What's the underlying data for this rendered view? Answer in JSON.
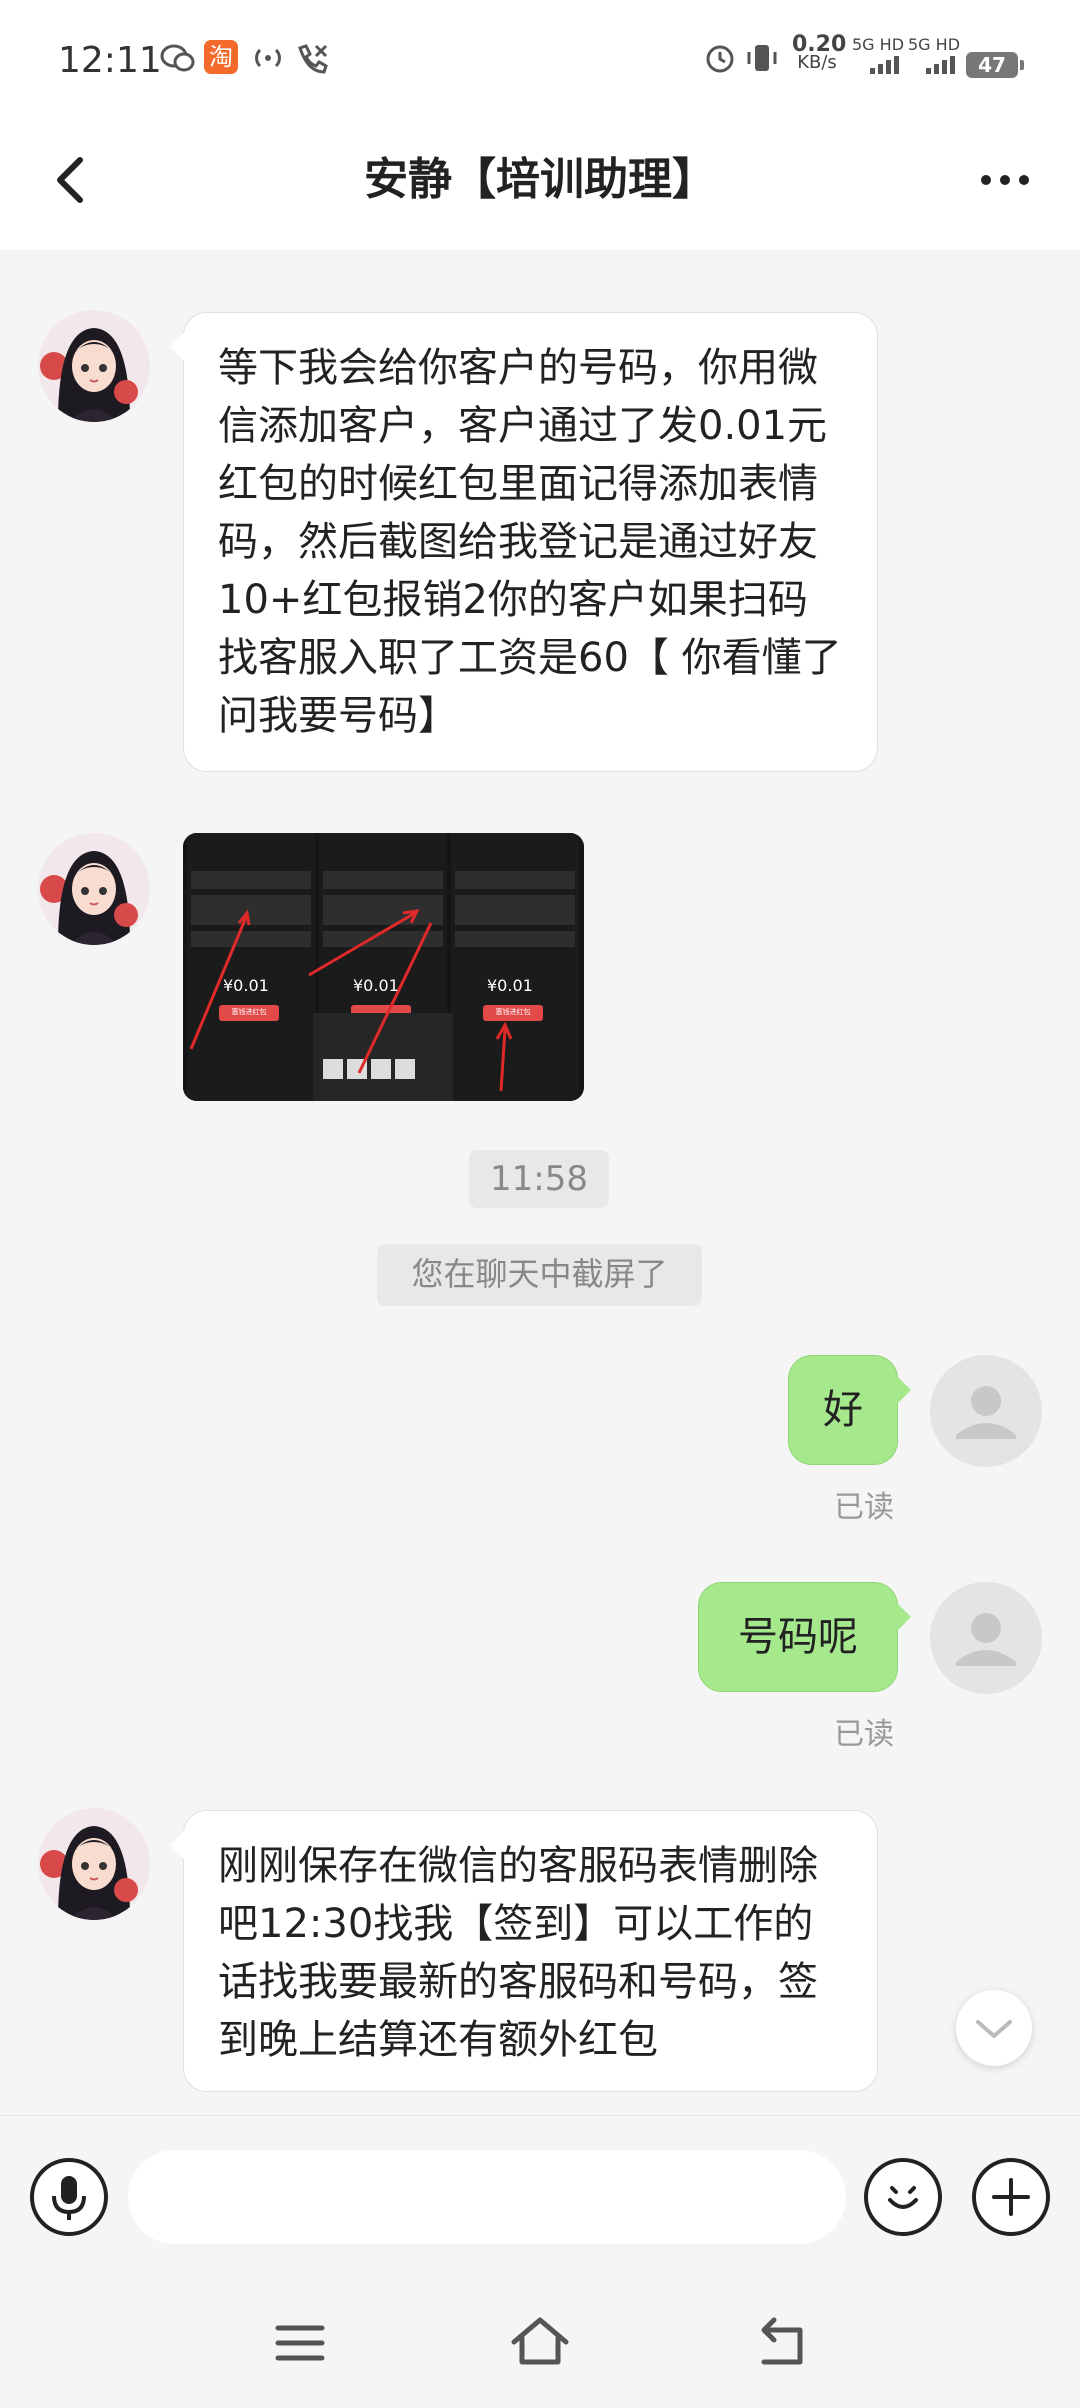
{
  "status_bar": {
    "time": "12:11",
    "net_speed_value": "0.20",
    "net_speed_unit": "KB/s",
    "sim1_label": "5G HD",
    "sim2_label": "5G HD",
    "battery": "47",
    "icons": [
      "wechat-icon",
      "taobao-icon",
      "hotspot-icon",
      "missed-call-icon",
      "alarm-icon",
      "vibrate-icon"
    ]
  },
  "header": {
    "title": "安静【培训助理】",
    "back_icon": "chevron-left-icon",
    "more_icon": "more-dots-icon"
  },
  "messages": {
    "m1_text": "等下我会给你客户的号码，你用微信添加客户，客户通过了发0.01元红包的时候红包里面记得添加表情码，然后截图给我登记是通过好友10+红包报销2你的客户如果扫码找客服入职了工资是60【 你看懂了 问我要号码】",
    "time_divider": "11:58",
    "screenshot_notice": "您在聊天中截屏了",
    "m3_text": "好",
    "m3_status": "已读",
    "m4_text": "号码呢",
    "m4_status": "已读",
    "m5_text": "刚刚保存在微信的客服码表情删除吧12:30找我【签到】可以工作的话找我要最新的客服码和号码，签到晚上结算还有额外红包"
  },
  "image_message": {
    "amount": "¥0.01",
    "button_label": "塞钱进红包"
  },
  "colors": {
    "outgoing_bubble": "#a6e88c",
    "incoming_bubble": "#ffffff",
    "chat_bg": "#f5f5f5",
    "arrow_red": "#e02a2a"
  },
  "input_bar": {
    "placeholder": "",
    "voice_icon": "microphone-icon",
    "emoji_icon": "emoji-icon",
    "plus_icon": "plus-icon"
  },
  "nav_bar": {
    "icons": [
      "menu-icon",
      "home-icon",
      "back-icon"
    ]
  }
}
